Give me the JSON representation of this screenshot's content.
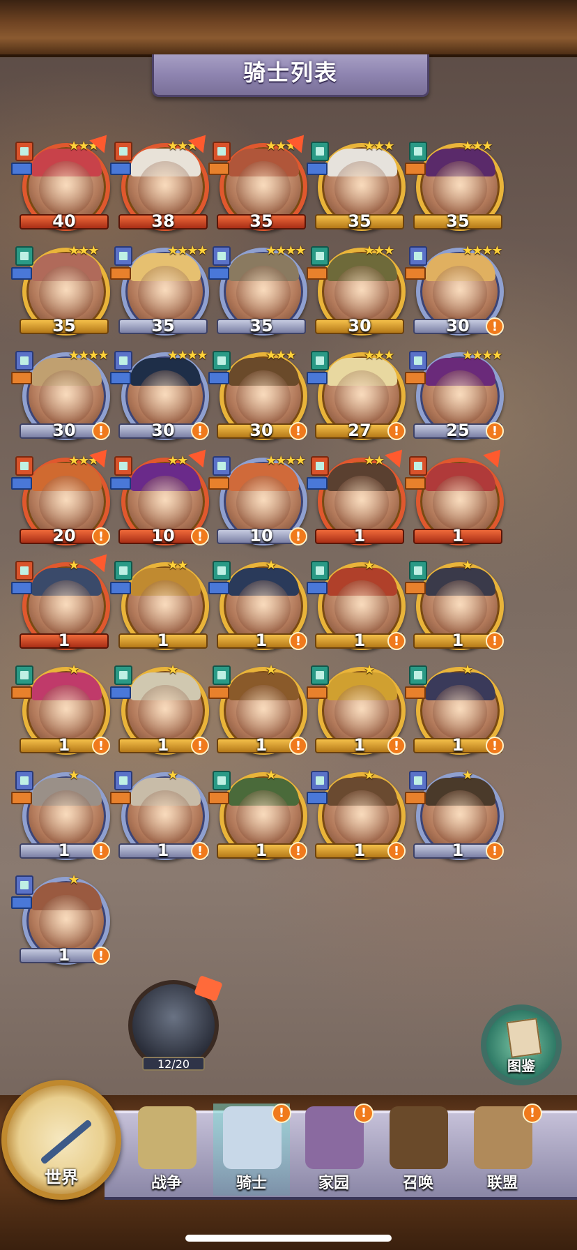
{
  "title": "骑士列表",
  "knights": [
    {
      "level": "40",
      "frame": "red",
      "stars": "★★★",
      "alert": false,
      "arrow": true,
      "cls": "red",
      "role": "blue",
      "hair": "#c8424a"
    },
    {
      "level": "38",
      "frame": "red",
      "stars": "★★★",
      "alert": false,
      "arrow": true,
      "cls": "red",
      "role": "blue",
      "hair": "#e8e2d8"
    },
    {
      "level": "35",
      "frame": "red",
      "stars": "★★★",
      "alert": false,
      "arrow": true,
      "cls": "red",
      "role": "orange",
      "hair": "#b0563a"
    },
    {
      "level": "35",
      "frame": "gold",
      "stars": "★★★",
      "alert": false,
      "arrow": false,
      "cls": "teal",
      "role": "blue",
      "hair": "#e6e2dc"
    },
    {
      "level": "35",
      "frame": "gold",
      "stars": "★★★",
      "alert": false,
      "arrow": false,
      "cls": "teal",
      "role": "orange",
      "hair": "#5a2a6a"
    },
    {
      "level": "35",
      "frame": "gold",
      "stars": "★★★",
      "alert": false,
      "arrow": false,
      "cls": "teal",
      "role": "blue",
      "hair": "#b06a5a"
    },
    {
      "level": "35",
      "frame": "blue",
      "stars": "★★★★",
      "alert": false,
      "arrow": false,
      "cls": "blue",
      "role": "orange",
      "hair": "#e6c070"
    },
    {
      "level": "35",
      "frame": "blue",
      "stars": "★★★★",
      "alert": false,
      "arrow": false,
      "cls": "blue",
      "role": "blue",
      "hair": "#8a7a60"
    },
    {
      "level": "30",
      "frame": "gold",
      "stars": "★★★",
      "alert": false,
      "arrow": false,
      "cls": "teal",
      "role": "orange",
      "hair": "#6e6a3a"
    },
    {
      "level": "30",
      "frame": "blue",
      "stars": "★★★★",
      "alert": true,
      "arrow": false,
      "cls": "blue",
      "role": "orange",
      "hair": "#e0b060"
    },
    {
      "level": "30",
      "frame": "blue",
      "stars": "★★★★",
      "alert": true,
      "arrow": false,
      "cls": "blue",
      "role": "orange",
      "hair": "#c0a070"
    },
    {
      "level": "30",
      "frame": "blue",
      "stars": "★★★★",
      "alert": true,
      "arrow": false,
      "cls": "blue",
      "role": "blue",
      "hair": "#1e2e48"
    },
    {
      "level": "30",
      "frame": "gold",
      "stars": "★★★",
      "alert": true,
      "arrow": false,
      "cls": "teal",
      "role": "blue",
      "hair": "#6a4a2a"
    },
    {
      "level": "27",
      "frame": "gold",
      "stars": "★★★",
      "alert": true,
      "arrow": false,
      "cls": "teal",
      "role": "blue",
      "hair": "#e8d8a0"
    },
    {
      "level": "25",
      "frame": "blue",
      "stars": "★★★★",
      "alert": true,
      "arrow": false,
      "cls": "blue",
      "role": "orange",
      "hair": "#6a2a7a"
    },
    {
      "level": "20",
      "frame": "red",
      "stars": "★★★",
      "alert": true,
      "arrow": true,
      "cls": "red",
      "role": "blue",
      "hair": "#d06a30"
    },
    {
      "level": "10",
      "frame": "red",
      "stars": "★★",
      "alert": true,
      "arrow": true,
      "cls": "red",
      "role": "blue",
      "hair": "#6a2a8a"
    },
    {
      "level": "10",
      "frame": "blue",
      "stars": "★★★★",
      "alert": true,
      "arrow": false,
      "cls": "blue",
      "role": "orange",
      "hair": "#d06a3a"
    },
    {
      "level": "1",
      "frame": "red",
      "stars": "★★",
      "alert": false,
      "arrow": true,
      "cls": "red",
      "role": "blue",
      "hair": "#5a4030"
    },
    {
      "level": "1",
      "frame": "red",
      "stars": "",
      "alert": false,
      "arrow": true,
      "cls": "red",
      "role": "orange",
      "hair": "#b03a3a"
    },
    {
      "level": "1",
      "frame": "red",
      "stars": "★",
      "alert": false,
      "arrow": true,
      "cls": "red",
      "role": "blue",
      "hair": "#3a4a6a"
    },
    {
      "level": "1",
      "frame": "gold",
      "stars": "★★",
      "alert": false,
      "arrow": false,
      "cls": "teal",
      "role": "blue",
      "hair": "#c08a30"
    },
    {
      "level": "1",
      "frame": "gold",
      "stars": "★",
      "alert": true,
      "arrow": false,
      "cls": "teal",
      "role": "blue",
      "hair": "#2a3a5a"
    },
    {
      "level": "1",
      "frame": "gold",
      "stars": "★",
      "alert": true,
      "arrow": false,
      "cls": "teal",
      "role": "blue",
      "hair": "#b0402a"
    },
    {
      "level": "1",
      "frame": "gold",
      "stars": "★",
      "alert": true,
      "arrow": false,
      "cls": "teal",
      "role": "orange",
      "hair": "#3a3a4a"
    },
    {
      "level": "1",
      "frame": "gold",
      "stars": "★",
      "alert": true,
      "arrow": false,
      "cls": "teal",
      "role": "orange",
      "hair": "#c03a6a"
    },
    {
      "level": "1",
      "frame": "gold",
      "stars": "★",
      "alert": true,
      "arrow": false,
      "cls": "teal",
      "role": "blue",
      "hair": "#d0c8b0"
    },
    {
      "level": "1",
      "frame": "gold",
      "stars": "★",
      "alert": true,
      "arrow": false,
      "cls": "teal",
      "role": "orange",
      "hair": "#8a5a2a"
    },
    {
      "level": "1",
      "frame": "gold",
      "stars": "★",
      "alert": true,
      "arrow": false,
      "cls": "teal",
      "role": "orange",
      "hair": "#d0a030"
    },
    {
      "level": "1",
      "frame": "gold",
      "stars": "★",
      "alert": true,
      "arrow": false,
      "cls": "teal",
      "role": "orange",
      "hair": "#3a3a5a"
    },
    {
      "level": "1",
      "frame": "blue",
      "stars": "★",
      "alert": true,
      "arrow": false,
      "cls": "blue",
      "role": "orange",
      "hair": "#9a9088"
    },
    {
      "level": "1",
      "frame": "blue",
      "stars": "★",
      "alert": true,
      "arrow": false,
      "cls": "blue",
      "role": "orange",
      "hair": "#c8bca8"
    },
    {
      "level": "1",
      "frame": "gold",
      "stars": "★",
      "alert": true,
      "arrow": false,
      "cls": "teal",
      "role": "orange",
      "hair": "#4a6a3a"
    },
    {
      "level": "1",
      "frame": "gold",
      "stars": "★",
      "alert": true,
      "arrow": false,
      "cls": "blue",
      "role": "blue",
      "hair": "#6a4a30"
    },
    {
      "level": "1",
      "frame": "blue",
      "stars": "★",
      "alert": true,
      "arrow": false,
      "cls": "blue",
      "role": "orange",
      "hair": "#4a3a2a"
    },
    {
      "level": "1",
      "frame": "blue",
      "stars": "★",
      "alert": true,
      "arrow": false,
      "cls": "blue",
      "role": "blue",
      "hair": "#9a5a40"
    }
  ],
  "fragment": {
    "progress": "12/20"
  },
  "codex": {
    "label": "图鉴"
  },
  "nav": {
    "world": "世界",
    "items": [
      {
        "label": "战争",
        "alert": false,
        "active": false,
        "color": "#c8b070"
      },
      {
        "label": "骑士",
        "alert": true,
        "active": true,
        "color": "#c8d8e8"
      },
      {
        "label": "家园",
        "alert": true,
        "active": false,
        "color": "#8a6aa0"
      },
      {
        "label": "召唤",
        "alert": false,
        "active": false,
        "color": "#6a4a2a"
      },
      {
        "label": "联盟",
        "alert": true,
        "active": false,
        "color": "#b08a5a"
      }
    ],
    "alert_glyph": "!"
  }
}
